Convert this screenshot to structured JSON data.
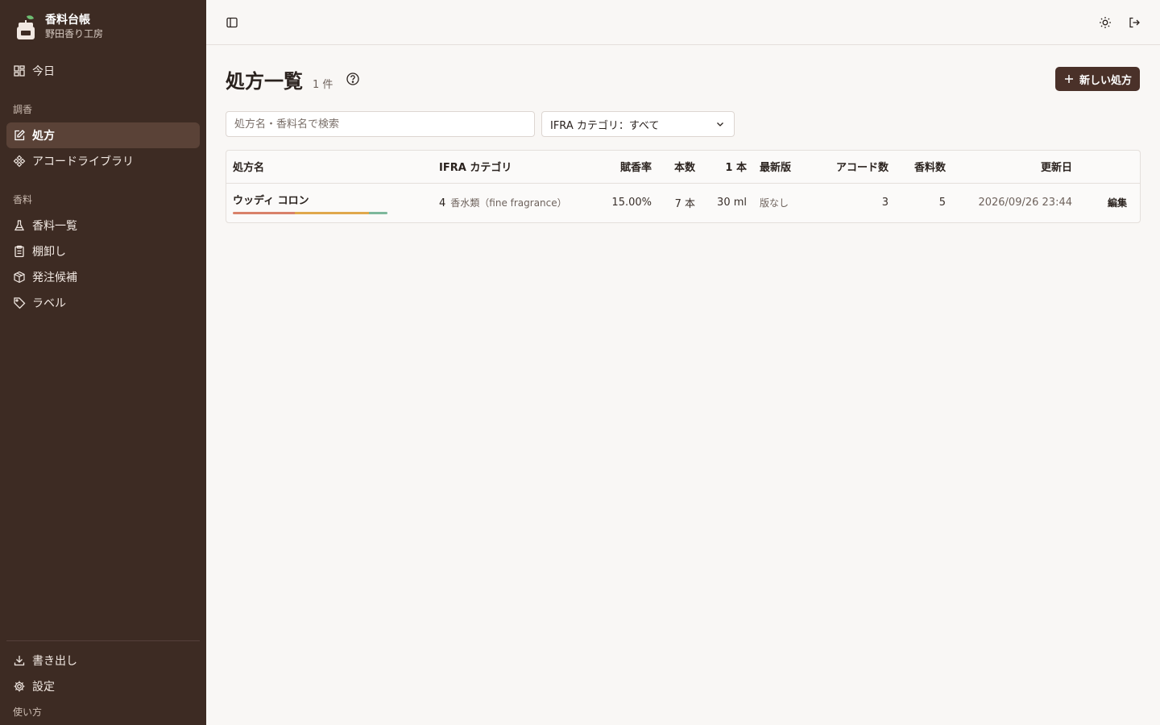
{
  "brand": {
    "title": "香料台帳",
    "subtitle": "野田香り工房"
  },
  "sidebar": {
    "today": "今日",
    "groups": [
      {
        "label": "調香",
        "items": [
          {
            "label": "処方",
            "icon": "edit-icon",
            "active": true
          },
          {
            "label": "アコードライブラリ",
            "icon": "diamonds-icon",
            "active": false
          }
        ]
      },
      {
        "label": "香料",
        "items": [
          {
            "label": "香料一覧",
            "icon": "flask-icon",
            "active": false
          },
          {
            "label": "棚卸し",
            "icon": "clipboard-icon",
            "active": false
          },
          {
            "label": "発注候補",
            "icon": "package-icon",
            "active": false
          },
          {
            "label": "ラベル",
            "icon": "tag-icon",
            "active": false
          }
        ]
      }
    ],
    "bottom": [
      {
        "label": "書き出し",
        "icon": "download-icon"
      },
      {
        "label": "設定",
        "icon": "gear-icon"
      }
    ],
    "usage": "使い方"
  },
  "page": {
    "title": "処方一覧",
    "count": "1 件",
    "new_button": "新しい処方",
    "search_placeholder": "処方名・香料名で検索",
    "ifra_filter": "IFRA カテゴリ：すべて"
  },
  "table": {
    "columns": [
      "処方名",
      "IFRA カテゴリ",
      "賦香率",
      "本数",
      "1 本",
      "最新版",
      "アコード数",
      "香料数",
      "更新日",
      ""
    ],
    "rows": [
      {
        "name": "ウッディ コロン",
        "accord_colors": [
          "#d9826a",
          "#e0a84c",
          "#7db89c"
        ],
        "accord_shares": [
          0.4,
          0.48,
          0.12
        ],
        "ifra_num": "4",
        "ifra_desc": "香水類（fine fragrance）",
        "ratio": "15.00%",
        "count": "7 本",
        "volume": "30 ml",
        "latest": "版なし",
        "accords": "3",
        "materials": "5",
        "updated": "2026/09/26 23:44",
        "edit": "編集"
      }
    ]
  },
  "colors": {
    "sidebar_bg": "#3d2b23",
    "active_bg": "#5a4237",
    "primary": "#4a3129",
    "page_bg": "#f9f7f5"
  }
}
